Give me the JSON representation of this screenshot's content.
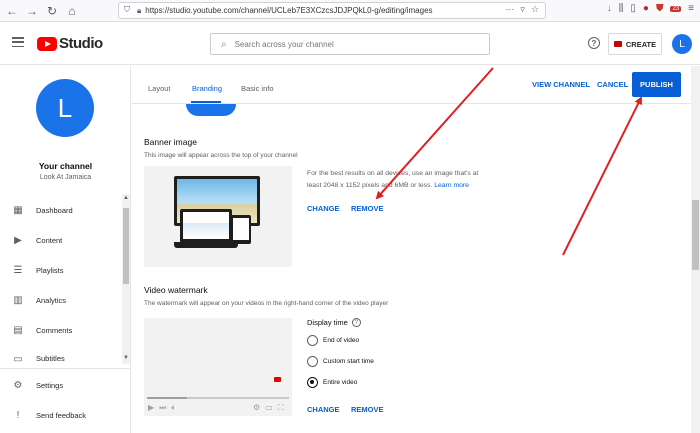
{
  "browser": {
    "url": "https://studio.youtube.com/channel/UCLeb7E3XCzcsJDJPQkL0-g/editing/images",
    "badge": "23"
  },
  "header": {
    "logo_text": "Studio",
    "search_placeholder": "Search across your channel",
    "create_label": "CREATE",
    "avatar_letter": "L"
  },
  "sidebar": {
    "avatar_letter": "L",
    "channel_title": "Your channel",
    "channel_name": "Look At Jamaica",
    "items": [
      {
        "label": "Dashboard",
        "icon": "dashboard-icon"
      },
      {
        "label": "Content",
        "icon": "content-icon"
      },
      {
        "label": "Playlists",
        "icon": "playlists-icon"
      },
      {
        "label": "Analytics",
        "icon": "analytics-icon"
      },
      {
        "label": "Comments",
        "icon": "comments-icon"
      },
      {
        "label": "Subtitles",
        "icon": "subtitles-icon"
      }
    ],
    "bottom_items": [
      {
        "label": "Settings",
        "icon": "gear-icon"
      },
      {
        "label": "Send feedback",
        "icon": "feedback-icon"
      }
    ]
  },
  "tabs": [
    {
      "label": "Layout",
      "active": false
    },
    {
      "label": "Branding",
      "active": true
    },
    {
      "label": "Basic info",
      "active": false
    }
  ],
  "actions": {
    "view_channel": "VIEW CHANNEL",
    "cancel": "CANCEL",
    "publish": "PUBLISH"
  },
  "banner": {
    "title": "Banner image",
    "description": "This image will appear across the top of your channel",
    "recommendation": "For the best results on all devices, use an image that's at least 2048 x 1152 pixels and 6MB or less.",
    "learn_more": "Learn more",
    "change": "CHANGE",
    "remove": "REMOVE"
  },
  "watermark": {
    "title": "Video watermark",
    "description": "The watermark will appear on your videos in the right-hand corner of the video player",
    "display_time_label": "Display time",
    "options": [
      {
        "label": "End of video",
        "selected": false
      },
      {
        "label": "Custom start time",
        "selected": false
      },
      {
        "label": "Entire video",
        "selected": true
      }
    ],
    "change": "CHANGE",
    "remove": "REMOVE"
  },
  "colors": {
    "accent": "#065fd4",
    "brand_red": "#ff0000",
    "arrow_red": "#e02020",
    "avatar_blue": "#1a73e8"
  }
}
